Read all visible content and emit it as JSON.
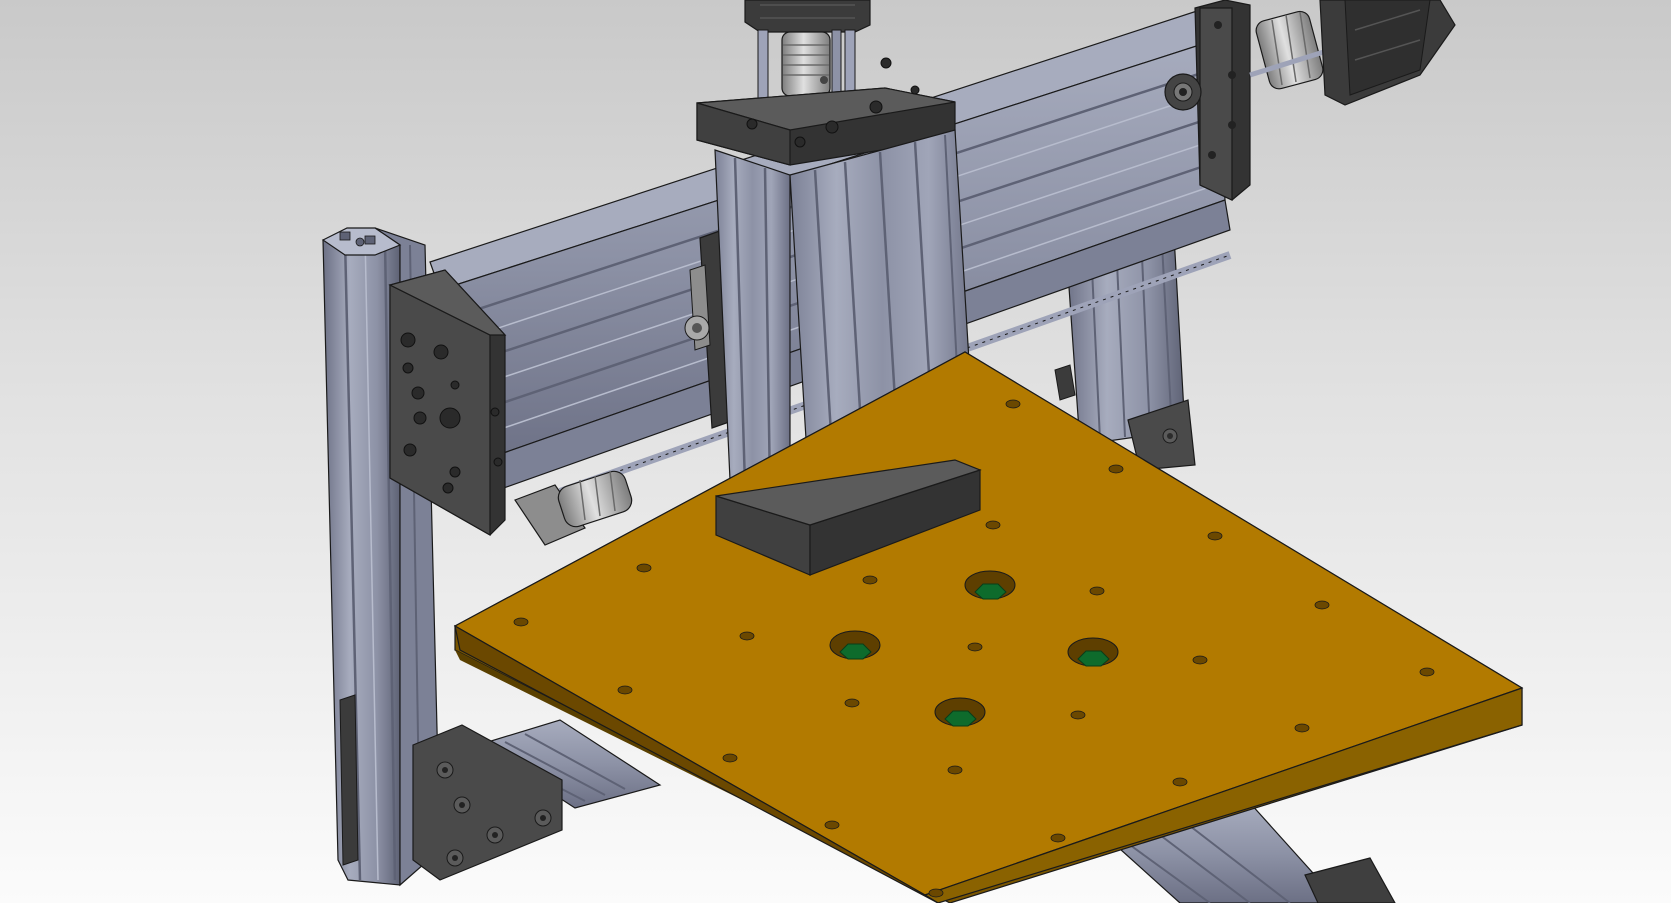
{
  "viewport": {
    "background_top": "#c9c9c9",
    "background_bottom": "#fbfbfb"
  },
  "model": {
    "colors": {
      "extrusion_face": "#8d92a6",
      "extrusion_light": "#a7acbe",
      "extrusion_dark": "#5e6275",
      "extrusion_groove": "#6c7085",
      "plate_dark": "#4a4a4a",
      "plate_side": "#333333",
      "plate_light": "#5b5b5b",
      "bed_top": "#b27a00",
      "bed_side": "#7a5600",
      "bed_hole": "#6b4800",
      "bolt_green": "#0e6b2c",
      "coupler": "#a9a9a9",
      "motor": "#3b3b3b",
      "rod": "#9ea3b8",
      "edge": "#1a1a1a"
    }
  }
}
